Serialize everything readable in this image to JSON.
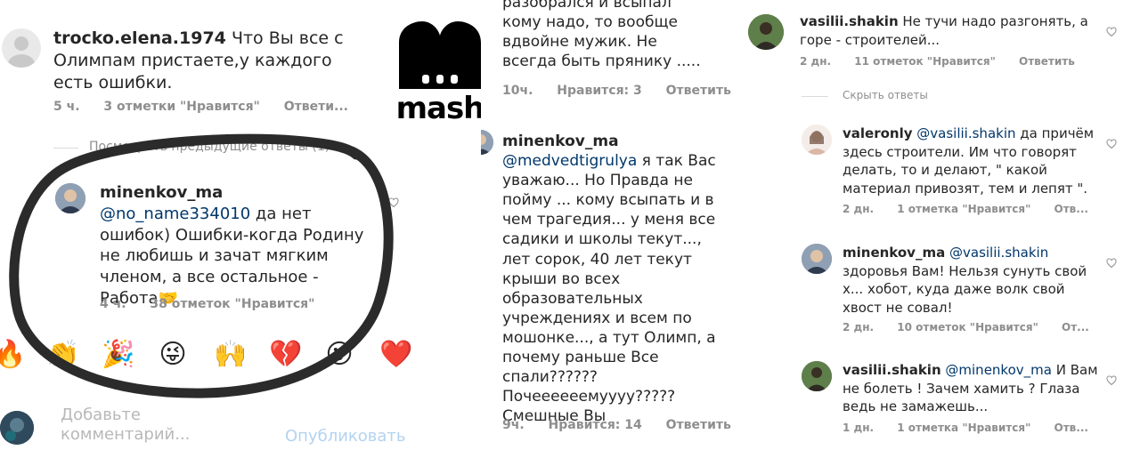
{
  "panel1": {
    "top_partial": "",
    "c1": {
      "user": "trocko.elena.1974",
      "text": "Что Вы все с Олимпам пристаете,у каждого есть ошибки.",
      "time": "5 ч.",
      "likes": "3 отметки \"Нравится\"",
      "reply": "Ответи..."
    },
    "view_prev": "Посмотреть предыдущие ответы (1)",
    "c2": {
      "user": "minenkov_ma",
      "mention": "@no_name334010",
      "text": "да нет ошибок) Ошибки-когда Родину не любишь и зачат мягким членом, а все остальное - Работа",
      "emoji_tail": "🤝",
      "time": "4 ч.",
      "likes": "38 отметок \"Нравится\""
    },
    "emojis": [
      "🔥",
      "👏",
      "🎉",
      "😜",
      "🙌",
      "💔",
      "😮",
      "❤️"
    ],
    "add_comment": "Добавьте комментарий...",
    "publish": "Опубликовать"
  },
  "logo": {
    "brand": "mash"
  },
  "panel2": {
    "top": {
      "text": "разобрался и всыпал кому надо, то вообще вдвойне мужик. Не всегда быть прянику .....",
      "time": "10ч.",
      "likes": "Нравится: 3",
      "reply": "Ответить"
    },
    "c1": {
      "user": "minenkov_ma",
      "mention": "@medvedtigrulya",
      "text": "я так Вас уважаю... Но Правда не пойму ... кому всыпать и в чем трагедия... у меня все садики и школы текут..., лет сорок, 40 лет текут крыши во всех образовательных учреждениях и всем по мошонке..., а тут Олимп, а почему раньше Все спали?????? Почеееееемуууу????? Смешные Вы",
      "time": "9ч.",
      "likes": "Нравится: 14",
      "reply": "Ответить"
    }
  },
  "panel3": {
    "c1": {
      "user": "vasilii.shakin",
      "text": "Не тучи надо разгонять, а горе - строителей...",
      "time": "2 дн.",
      "likes": "11 отметок \"Нравится\"",
      "reply": "Ответить"
    },
    "hide_replies": "Скрыть ответы",
    "r1": {
      "user": "valeronly",
      "mention": "@vasilii.shakin",
      "text": "да причём здесь строители. Им что говорят делать, то и делают, \" какой материал привозят, тем и лепят \".",
      "time": "2 дн.",
      "likes": "1 отметка \"Нравится\"",
      "reply": "Отв..."
    },
    "r2": {
      "user": "minenkov_ma",
      "mention": "@vasilii.shakin",
      "text": "здоровья Вам! Нельзя сунуть свой х... хобот, куда даже волк свой хвост не совал!",
      "time": "2 дн.",
      "likes": "10 отметок \"Нравится\"",
      "reply": "От..."
    },
    "r3": {
      "user": "vasilii.shakin",
      "mention": "@minenkov_ma",
      "text": "И Вам не болеть ! Зачем хамить ? Глаза ведь не замажешь...",
      "time": "1 дн.",
      "likes": "1 отметка \"Нравится\"",
      "reply": "Отв..."
    }
  },
  "colors": {
    "meta": "#8e8e8e",
    "mention": "#00376b",
    "circle": "#2b2b2b",
    "publish": "#b3d3f0"
  }
}
